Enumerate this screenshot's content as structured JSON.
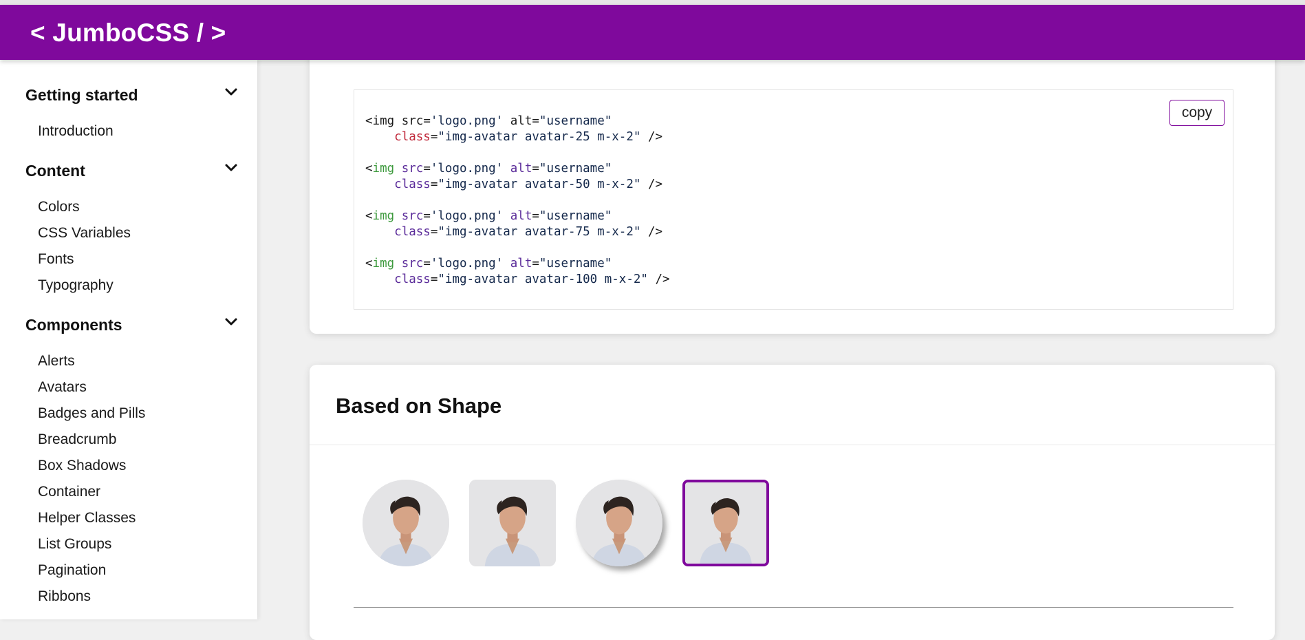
{
  "app": {
    "brand": "< JumboCSS / >",
    "accent_color": "#7f099c"
  },
  "sidebar": {
    "sections": [
      {
        "title": "Getting started",
        "icon": "chevron-down-icon",
        "items": [
          "Introduction"
        ]
      },
      {
        "title": "Content",
        "icon": "chevron-down-icon",
        "items": [
          "Colors",
          "CSS Variables",
          "Fonts",
          "Typography"
        ]
      },
      {
        "title": "Components",
        "icon": "chevron-down-icon",
        "items": [
          "Alerts",
          "Avatars",
          "Badges and Pills",
          "Breadcrumb",
          "Box Shadows",
          "Container",
          "Helper Classes",
          "List Groups",
          "Pagination",
          "Ribbons"
        ]
      }
    ]
  },
  "code_card": {
    "copy_label": "copy",
    "lines": [
      "<img src='logo.png' alt=\"username\"",
      "    class=\"img-avatar avatar-25 m-x-2\" />",
      "<img src='logo.png' alt=\"username\"",
      "    class=\"img-avatar avatar-50 m-x-2\" />",
      "<img src='logo.png' alt=\"username\"",
      "    class=\"img-avatar avatar-75 m-x-2\" />",
      "<img src='logo.png' alt=\"username\"",
      "    class=\"img-avatar avatar-100 m-x-2\" />"
    ],
    "tokens": {
      "lt": "<",
      "img": "img",
      "src": "src",
      "eq": "=",
      "src_val": "'logo.png'",
      "alt": "alt",
      "alt_val": "\"username\"",
      "class": "class",
      "class_vals": [
        "\"img-avatar avatar-25 m-x-2\"",
        "\"img-avatar avatar-50 m-x-2\"",
        "\"img-avatar avatar-75 m-x-2\"",
        "\"img-avatar avatar-100 m-x-2\""
      ],
      "close": " />"
    }
  },
  "shape_card": {
    "title": "Based on Shape",
    "avatars": [
      {
        "shape": "round",
        "alt": "username"
      },
      {
        "shape": "rounded-square",
        "alt": "username"
      },
      {
        "shape": "round-shadow",
        "alt": "username"
      },
      {
        "shape": "bordered-square",
        "alt": "username"
      }
    ]
  }
}
